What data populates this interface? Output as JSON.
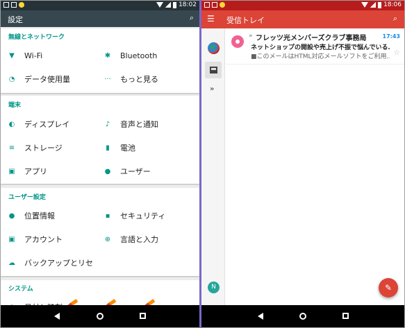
{
  "left": {
    "status": {
      "time": "18:02"
    },
    "toolbar": {
      "title": "設定",
      "search_icon": "search-icon"
    },
    "sections": [
      {
        "header": "無線とネットワーク",
        "items": [
          {
            "label": "Wi-Fi",
            "icon": "wifi-icon"
          },
          {
            "label": "Bluetooth",
            "icon": "bluetooth-icon"
          },
          {
            "label": "データ使用量",
            "icon": "data-usage-icon"
          },
          {
            "label": "もっと見る",
            "icon": "more-icon"
          }
        ]
      },
      {
        "header": "端末",
        "items": [
          {
            "label": "ディスプレイ",
            "icon": "display-icon"
          },
          {
            "label": "音声と通知",
            "icon": "bell-icon"
          },
          {
            "label": "ストレージ",
            "icon": "storage-icon"
          },
          {
            "label": "電池",
            "icon": "battery-icon"
          },
          {
            "label": "アプリ",
            "icon": "android-icon"
          },
          {
            "label": "ユーザー",
            "icon": "user-icon"
          }
        ]
      },
      {
        "header": "ユーザー設定",
        "items": [
          {
            "label": "位置情報",
            "icon": "location-icon"
          },
          {
            "label": "セキュリティ",
            "icon": "lock-icon"
          },
          {
            "label": "アカウント",
            "icon": "account-icon"
          },
          {
            "label": "言語と入力",
            "icon": "globe-icon"
          },
          {
            "label": "バックアップとリセ",
            "icon": "cloud-upload-icon"
          }
        ]
      },
      {
        "header": "システム",
        "items": [
          {
            "label": "日付と時刻",
            "icon": "clock-icon"
          }
        ]
      }
    ],
    "icons_glyphs": {
      "wifi": "▼",
      "bluetooth": "✱",
      "data": "◔",
      "more": "···",
      "display": "◐",
      "bell": "🔔",
      "storage": "≡",
      "battery": "▮",
      "android": "▣",
      "user": "👤",
      "location": "●",
      "lock": "🔒",
      "account": "▣",
      "globe": "⊕",
      "cloud": "☁",
      "clock": "◷"
    }
  },
  "right": {
    "status": {
      "time": "18:06"
    },
    "toolbar": {
      "title": "受信トレイ"
    },
    "rail": {
      "account_letter": "N"
    },
    "message": {
      "sender": "フレッツ光メンバーズクラブ事務局",
      "time": "17:43",
      "subject": "ネットショップの開設や売上げ不振で悩んでいる…",
      "snippet": "■このメールはHTML対応メールソフトをご利用…",
      "star": "☆",
      "chevron": "»"
    },
    "fab_glyph": "✎"
  },
  "colors": {
    "teal": "#009688",
    "gmail_red": "#db4437",
    "settings_dark": "#37474f"
  }
}
